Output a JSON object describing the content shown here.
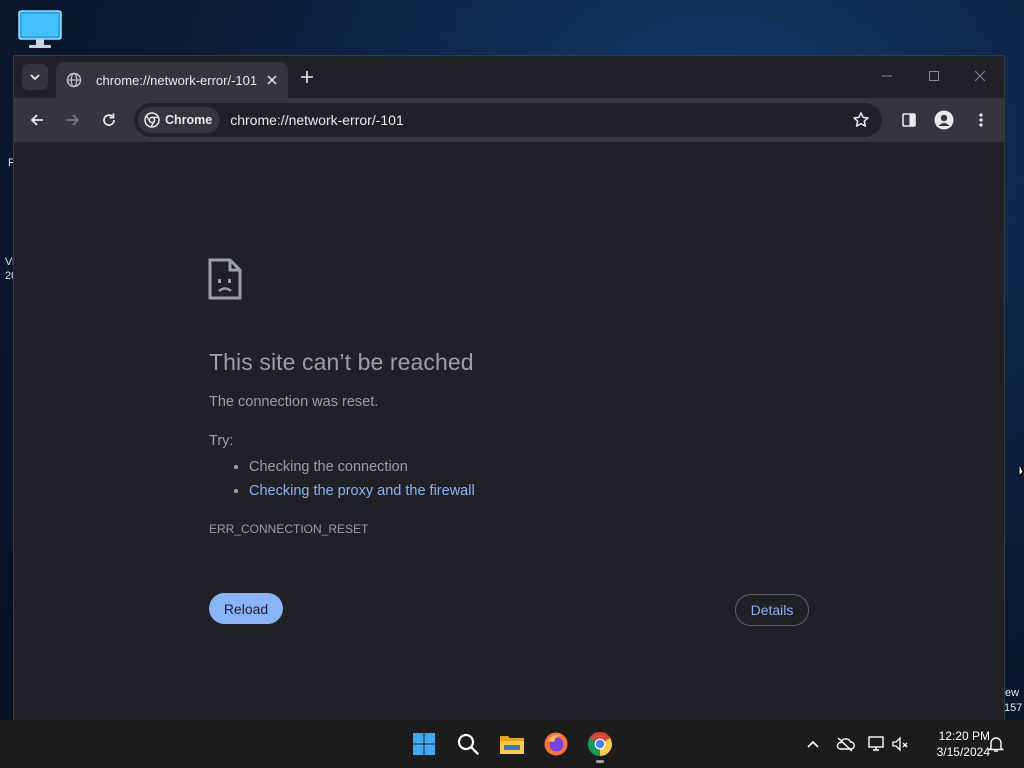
{
  "desktop": {
    "fragments": [
      "R",
      "Vi",
      "20",
      "ew",
      "157"
    ]
  },
  "browser": {
    "tab": {
      "title": "chrome://network-error/-101"
    },
    "omnibox": {
      "chip_label": "Chrome",
      "url": "chrome://network-error/-101"
    }
  },
  "error_page": {
    "title": "This site can’t be reached",
    "description": "The connection was reset.",
    "try_label": "Try:",
    "suggestions": [
      "Checking the connection",
      "Checking the proxy and the firewall"
    ],
    "error_code": "ERR_CONNECTION_RESET",
    "reload_label": "Reload",
    "details_label": "Details"
  },
  "taskbar": {
    "time": "12:20 PM",
    "date": "3/15/2024"
  },
  "colors": {
    "link": "#8ab4f8",
    "page_bg": "#202124",
    "muted_text": "#9aa0a6"
  }
}
